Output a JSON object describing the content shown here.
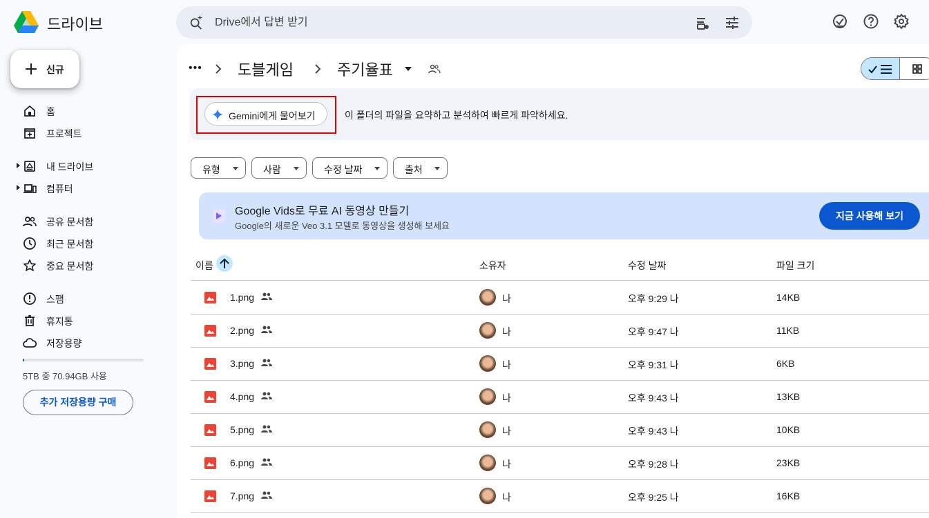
{
  "app": {
    "title": "드라이브"
  },
  "search": {
    "placeholder": "Drive에서 답변 받기"
  },
  "sidebar": {
    "new_label": "신규",
    "items": [
      {
        "label": "홈",
        "icon": "home-icon"
      },
      {
        "label": "프로젝트",
        "icon": "projects-icon"
      },
      {
        "label": "내 드라이브",
        "icon": "my-drive-icon"
      },
      {
        "label": "컴퓨터",
        "icon": "computer-icon"
      },
      {
        "label": "공유 문서함",
        "icon": "shared-icon"
      },
      {
        "label": "최근 문서함",
        "icon": "clock-icon"
      },
      {
        "label": "중요 문서함",
        "icon": "star-icon"
      },
      {
        "label": "스팸",
        "icon": "spam-icon"
      },
      {
        "label": "휴지통",
        "icon": "trash-icon"
      },
      {
        "label": "저장용량",
        "icon": "cloud-icon"
      }
    ],
    "storage_text": "5TB 중 70.94GB 사용",
    "storage_fraction": 0.014,
    "buy_storage_label": "추가 저장용량 구매"
  },
  "breadcrumb": {
    "more": "•••",
    "parent": "도블게임",
    "current": "주기율표"
  },
  "gemini": {
    "button_label": "Gemini에게 물어보기",
    "description": "이 폴더의 파일을 요약하고 분석하여 빠르게 파악하세요."
  },
  "filters": [
    "유형",
    "사람",
    "수정 날짜",
    "출처"
  ],
  "promo": {
    "title": "Google Vids로 무료 AI 동영상 만들기",
    "subtitle": "Google의 새로운 Veo 3.1 모델로 동영상을 생성해 보세요",
    "button_label": "지금 사용해 보기"
  },
  "table": {
    "columns": {
      "name": "이름",
      "owner": "소유자",
      "modified": "수정 날짜",
      "size": "파일 크기"
    },
    "rows": [
      {
        "name": "1.png",
        "owner": "나",
        "modified": "오후 9:29 나",
        "size": "14KB"
      },
      {
        "name": "2.png",
        "owner": "나",
        "modified": "오후 9:47 나",
        "size": "11KB"
      },
      {
        "name": "3.png",
        "owner": "나",
        "modified": "오후 9:31 나",
        "size": "6KB"
      },
      {
        "name": "4.png",
        "owner": "나",
        "modified": "오후 9:43 나",
        "size": "13KB"
      },
      {
        "name": "5.png",
        "owner": "나",
        "modified": "오후 9:43 나",
        "size": "10KB"
      },
      {
        "name": "6.png",
        "owner": "나",
        "modified": "오후 9:28 나",
        "size": "23KB"
      },
      {
        "name": "7.png",
        "owner": "나",
        "modified": "오후 9:25 나",
        "size": "16KB"
      }
    ]
  },
  "colors": {
    "accent": "#0b57d0",
    "selected": "#c2e7ff",
    "file_icon": "#ea4335",
    "highlight": "#e00000"
  }
}
